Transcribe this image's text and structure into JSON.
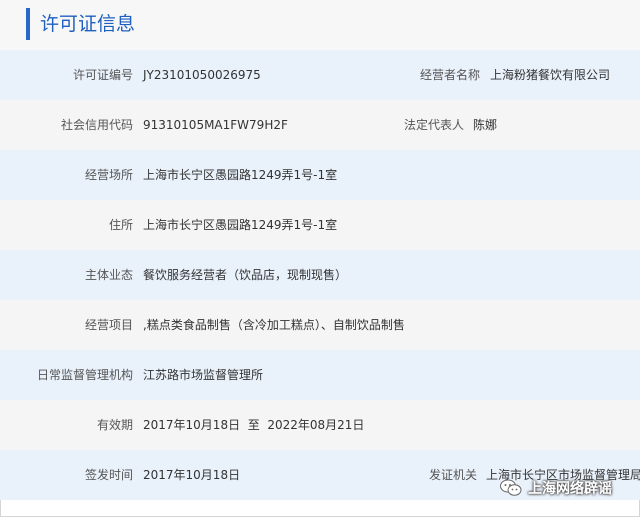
{
  "header": {
    "title": "许可证信息"
  },
  "rows": [
    {
      "label": "许可证编号",
      "value": "JY23101050026975",
      "label2": "经营者名称",
      "value2": "上海粉猪餐饮有限公司"
    },
    {
      "label": "社会信用代码",
      "value": "91310105MA1FW79H2F",
      "label2": "法定代表人",
      "value2": "陈娜"
    },
    {
      "label": "经营场所",
      "value": "上海市长宁区愚园路1249弄1号-1室"
    },
    {
      "label": "住所",
      "value": "上海市长宁区愚园路1249弄1号-1室"
    },
    {
      "label": "主体业态",
      "value": "餐饮服务经营者（饮品店，现制现售）"
    },
    {
      "label": "经营项目",
      "value": ",糕点类食品制售（含冷加工糕点）、自制饮品制售"
    },
    {
      "label": "日常监督管理机构",
      "value": "江苏路市场监督管理所"
    },
    {
      "label": "有效期",
      "value": "2017年10月18日  至  2022年08月21日"
    },
    {
      "label": "签发时间",
      "value": "2017年10月18日",
      "label2": "发证机关",
      "value2": "上海市长宁区市场监督管理局"
    }
  ],
  "watermark": {
    "text": "上海网络辟谣",
    "icon": "wechat-icon"
  }
}
